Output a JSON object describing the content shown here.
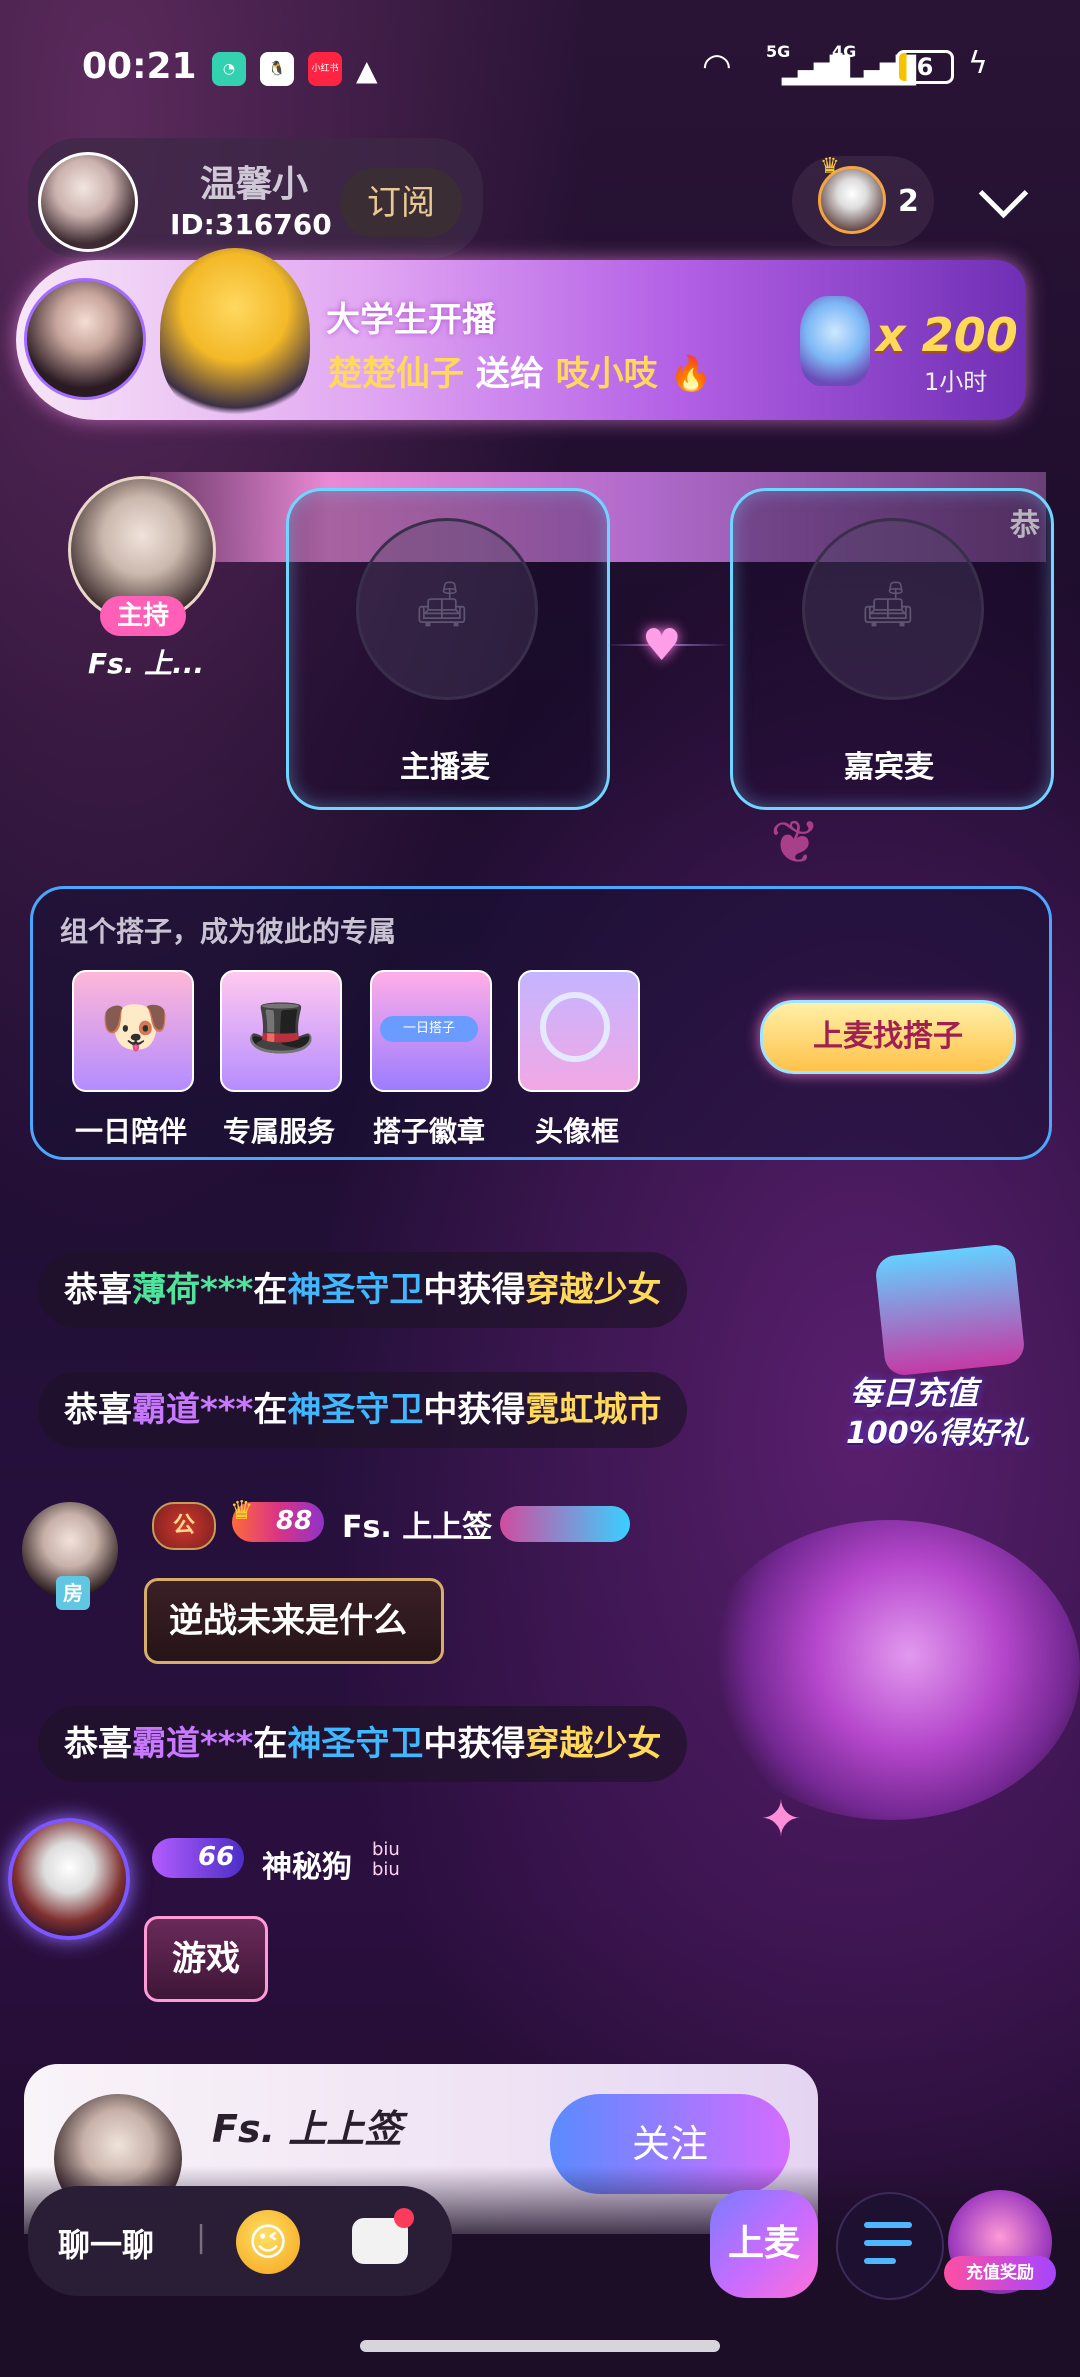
{
  "status_bar": {
    "time": "00:21",
    "signal_labels": [
      "5G",
      "4G"
    ],
    "battery": "6",
    "app_icons": [
      "chat-app-icon",
      "qq-icon",
      "xiaohongshu-icon",
      "warning-icon"
    ],
    "xiaohongshu_text": "小红书"
  },
  "header": {
    "room_name": "温馨小",
    "room_id": "ID:316760",
    "subscribe_label": "订阅",
    "audience_count": "2"
  },
  "gift_banner": {
    "title": "大学生开播",
    "sender": "楚楚仙子",
    "action": "送给",
    "receiver": "吱小吱",
    "quantity": "x 200",
    "duration": "1小时"
  },
  "host": {
    "badge": "主持",
    "name": "Fs. 上...",
    "marquee_text": "恭"
  },
  "seats": [
    {
      "label": "主播麦"
    },
    {
      "label": "嘉宾麦"
    }
  ],
  "partner_card": {
    "title": "组个搭子，成为彼此的专属",
    "items": [
      {
        "label": "一日陪伴"
      },
      {
        "label": "专属服务"
      },
      {
        "label": "搭子徽章",
        "inner_text": "一日搭子"
      },
      {
        "label": "头像框"
      }
    ],
    "cta": "上麦找搭子"
  },
  "messages": {
    "system1": {
      "prefix": "恭喜",
      "user": "薄荷***",
      "mid1": "在",
      "game": "神圣守卫",
      "mid2": "中获得",
      "prize": "穿越少女"
    },
    "system2": {
      "prefix": "恭喜",
      "user": "霸道***",
      "mid1": "在",
      "game": "神圣守卫",
      "mid2": "中获得",
      "prize": "霓虹城市"
    },
    "user1": {
      "room_badge": "房",
      "badge_gong": "公",
      "level": "88",
      "name": "Fs. 上上签",
      "text": "逆战未来是什么"
    },
    "system3": {
      "prefix": "恭喜",
      "user": "霸道***",
      "mid1": "在",
      "game": "神圣守卫",
      "mid2": "中获得",
      "prize": "穿越少女"
    },
    "user2": {
      "level": "66",
      "name": "神秘狗",
      "sticker_text": "biu biu",
      "text": "游戏"
    }
  },
  "promo": {
    "line1": "每日充值",
    "line2": "100%得好礼"
  },
  "follow_card": {
    "name": "Fs. 上上签",
    "follow_label": "关注"
  },
  "bottom_bar": {
    "chat_placeholder": "聊一聊",
    "divider": "|",
    "mic_label": "上麦",
    "recharge_label": "充值奖励"
  },
  "colors": {
    "accent_pink": "#ff5fb7",
    "accent_blue": "#3fb8ff",
    "accent_gold": "#ffd95a",
    "accent_green": "#4fe39b",
    "accent_purple": "#c878ff"
  }
}
